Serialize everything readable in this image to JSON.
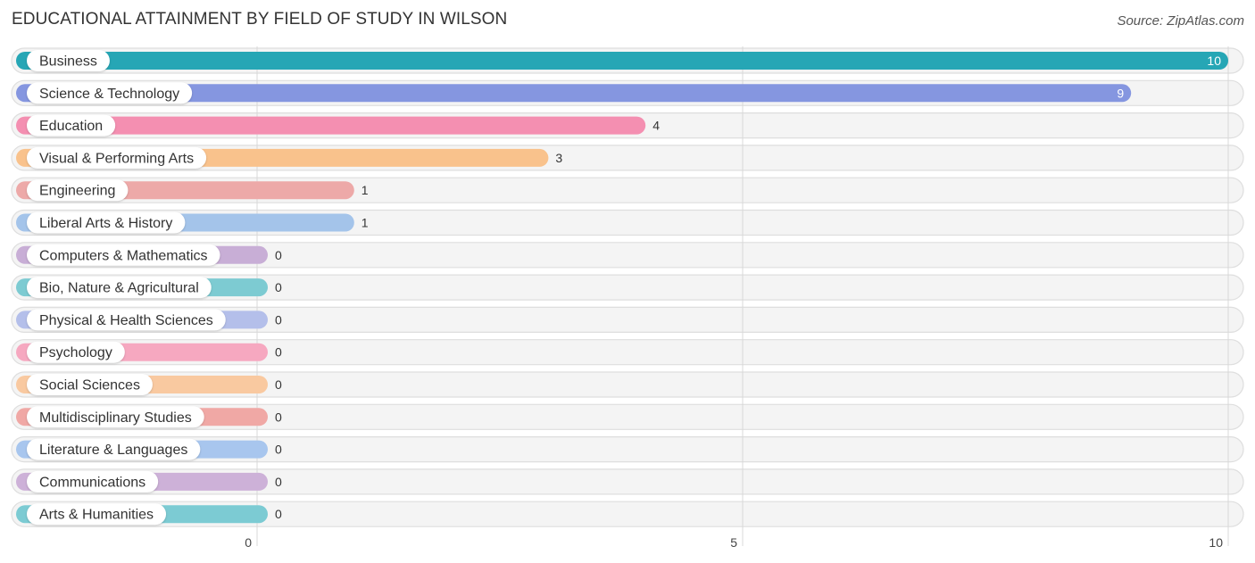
{
  "header": {
    "title": "EDUCATIONAL ATTAINMENT BY FIELD OF STUDY IN WILSON",
    "source": "Source: ZipAtlas.com"
  },
  "chart_data": {
    "type": "bar",
    "orientation": "horizontal",
    "title": "EDUCATIONAL ATTAINMENT BY FIELD OF STUDY IN WILSON",
    "source": "Source: ZipAtlas.com",
    "xlabel": "",
    "ylabel": "",
    "xlim": [
      0,
      10
    ],
    "xticks": [
      0,
      5,
      10
    ],
    "grid": true,
    "categories": [
      "Business",
      "Science & Technology",
      "Education",
      "Visual & Performing Arts",
      "Engineering",
      "Liberal Arts & History",
      "Computers & Mathematics",
      "Bio, Nature & Agricultural",
      "Physical & Health Sciences",
      "Psychology",
      "Social Sciences",
      "Multidisciplinary Studies",
      "Literature & Languages",
      "Communications",
      "Arts & Humanities"
    ],
    "values": [
      10,
      9,
      4,
      3,
      1,
      1,
      0,
      0,
      0,
      0,
      0,
      0,
      0,
      0,
      0
    ],
    "colors": [
      "#26a6b5",
      "#8596e0",
      "#f48fb1",
      "#f9c28c",
      "#eda9a8",
      "#a4c4ea",
      "#c8aed6",
      "#7dcbd2",
      "#b4bfea",
      "#f6a8c0",
      "#f9c9a0",
      "#f0a8a5",
      "#a8c6ee",
      "#cdb1d8",
      "#7ccbd3"
    ]
  }
}
